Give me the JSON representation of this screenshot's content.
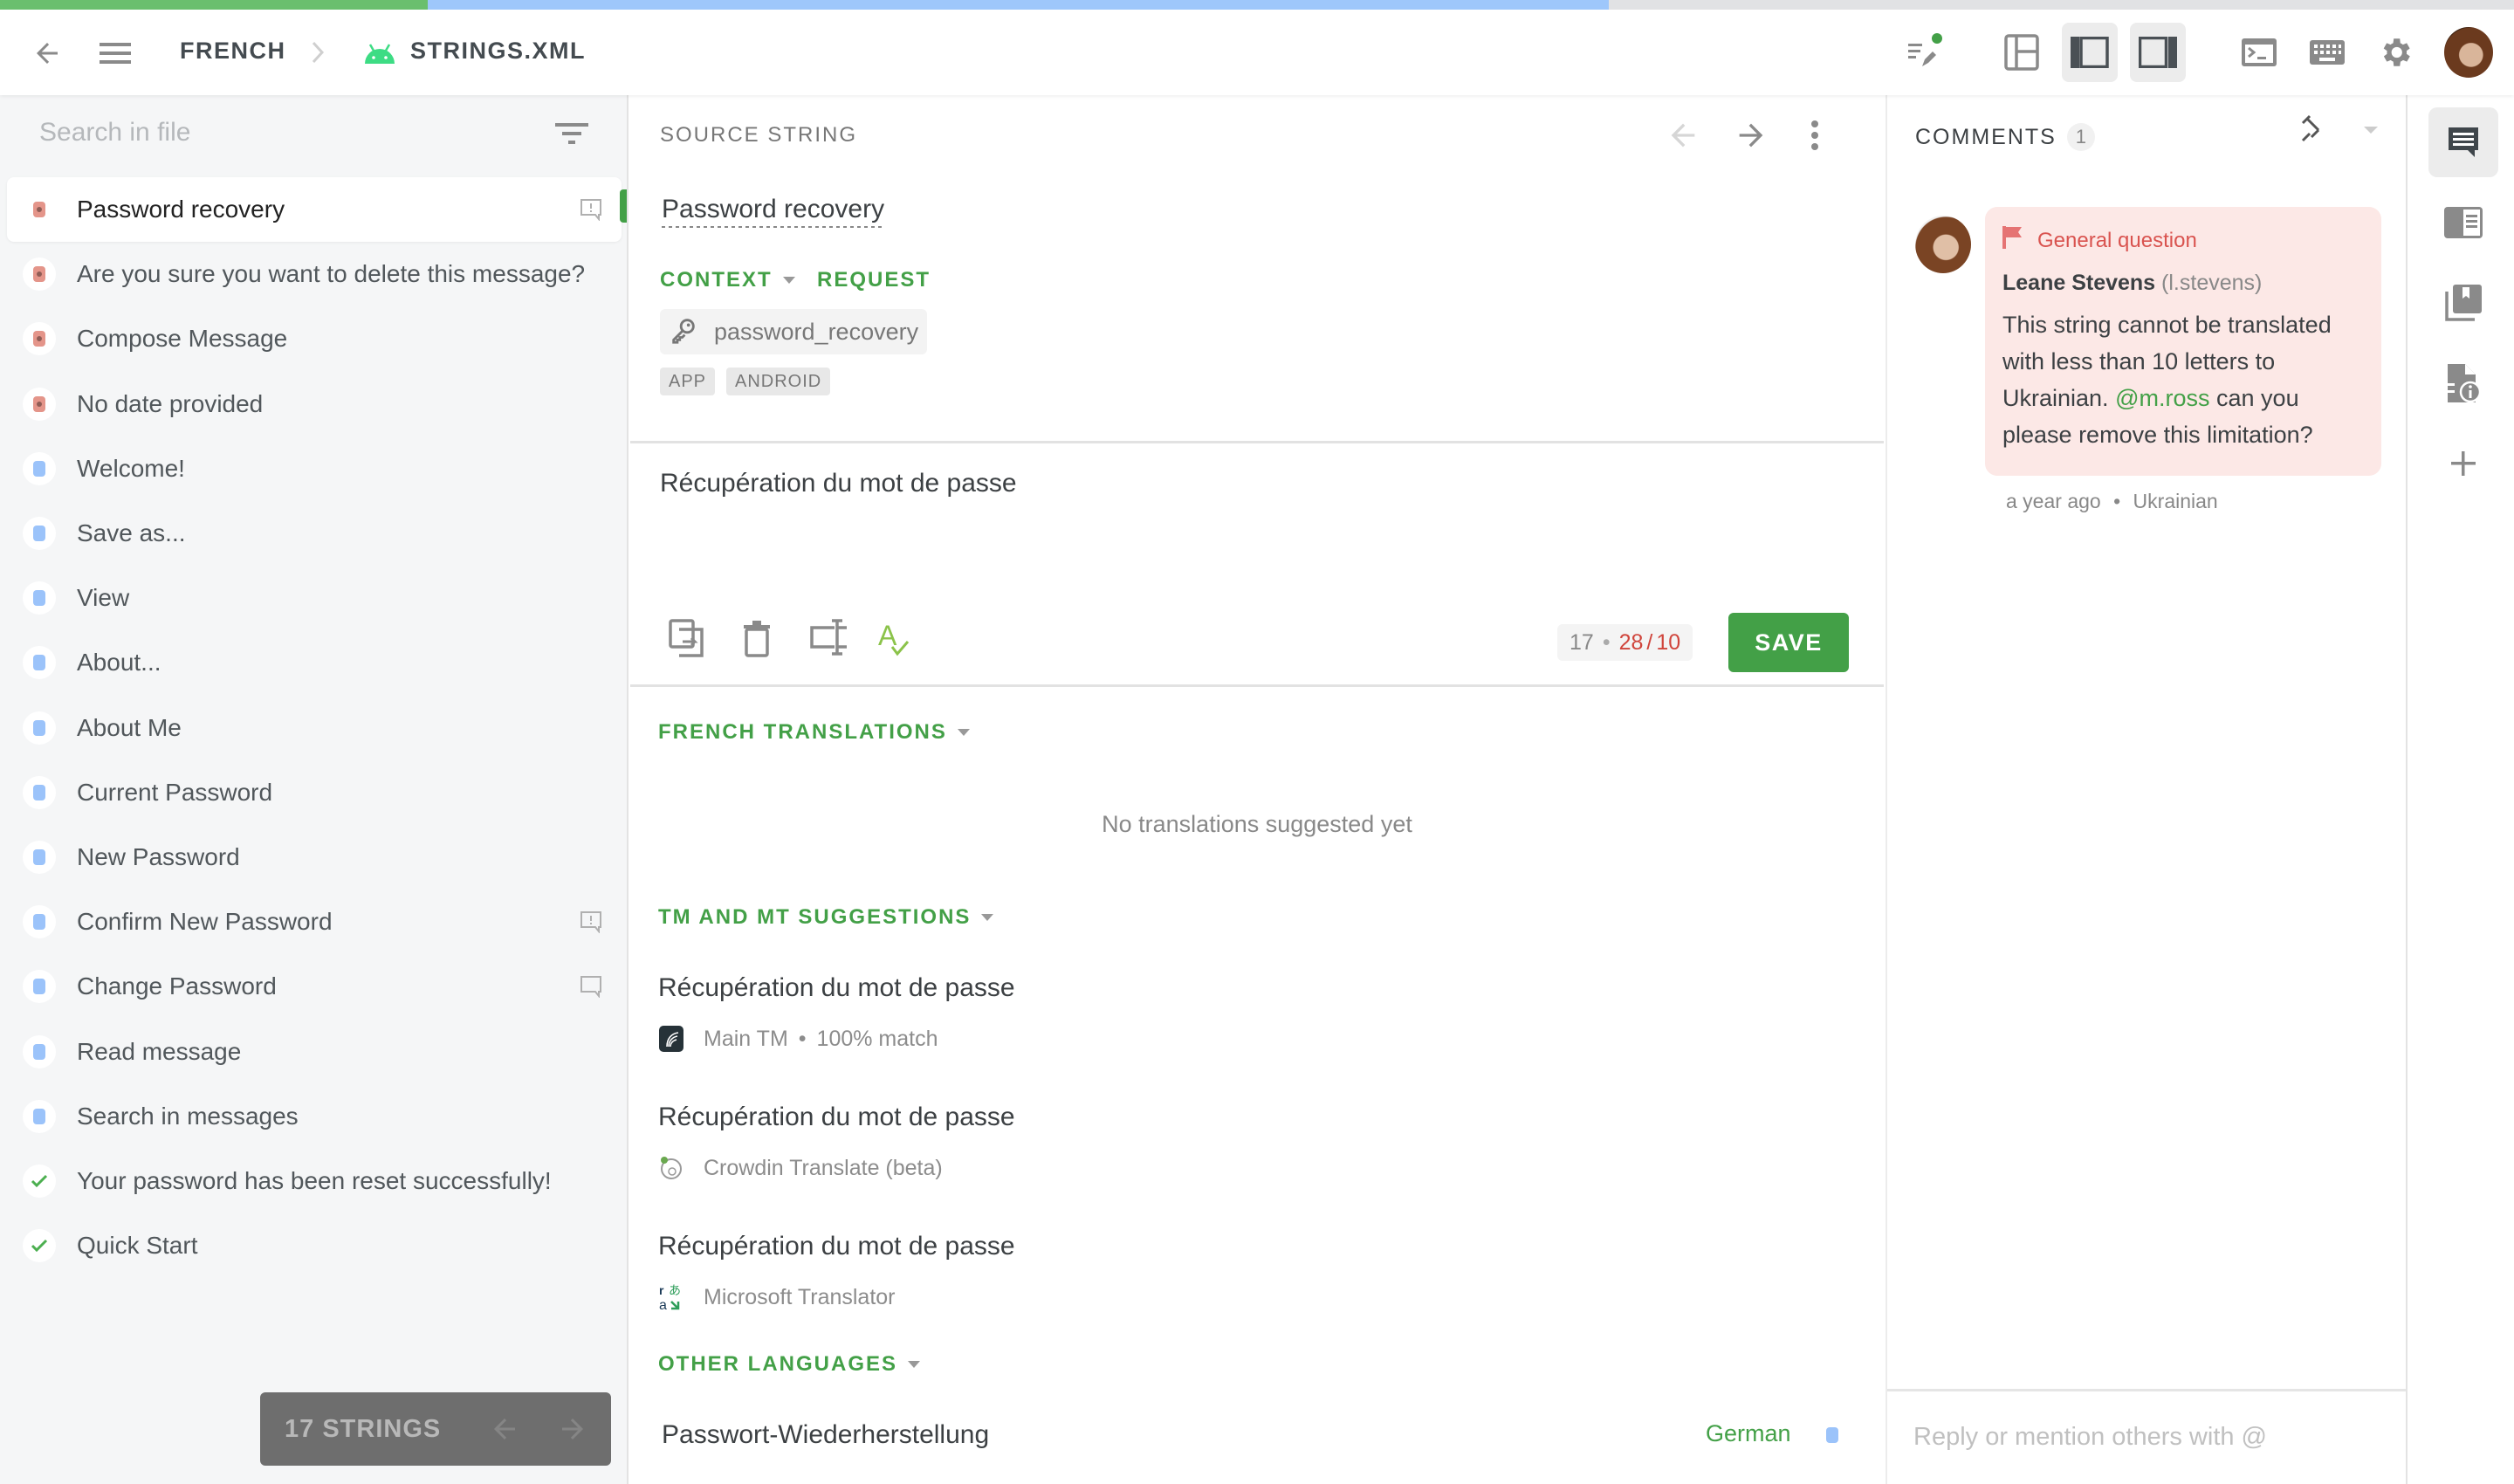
{
  "progress": {
    "approved_fraction": 0.17,
    "translated_fraction": 0.64,
    "approved_color": "#6abf6e",
    "translated_color": "#9ec7fb"
  },
  "header": {
    "back_icon": "arrow-left-icon",
    "menu_icon": "hamburger-menu-icon",
    "breadcrumb": [
      "FRENCH",
      "STRINGS.XML"
    ],
    "file_icon": "android-icon",
    "toolbar_icons": [
      "edit-list-icon",
      "layout-three-panel-icon",
      "layout-left-panel-icon",
      "layout-right-panel-icon",
      "terminal-icon",
      "keyboard-icon",
      "gear-icon",
      "user-avatar"
    ],
    "notification_dot_color": "#43a047"
  },
  "sidebar": {
    "search_placeholder": "Search in file",
    "items": [
      {
        "label": "Password recovery",
        "status": "untranslated",
        "selected": true,
        "comment": "issue"
      },
      {
        "label": "Are you sure you want to delete this message?",
        "status": "untranslated"
      },
      {
        "label": "Compose Message",
        "status": "untranslated"
      },
      {
        "label": "No date provided",
        "status": "untranslated"
      },
      {
        "label": "Welcome!",
        "status": "translated"
      },
      {
        "label": "Save as...",
        "status": "translated"
      },
      {
        "label": "View",
        "status": "translated"
      },
      {
        "label": "About...",
        "status": "translated"
      },
      {
        "label": "About Me",
        "status": "translated"
      },
      {
        "label": "Current Password",
        "status": "translated"
      },
      {
        "label": "New Password",
        "status": "translated"
      },
      {
        "label": "Confirm New Password",
        "status": "translated",
        "comment": "issue"
      },
      {
        "label": "Change Password",
        "status": "translated",
        "comment": "plain"
      },
      {
        "label": "Read message",
        "status": "translated"
      },
      {
        "label": "Search in messages",
        "status": "translated"
      },
      {
        "label": "Your password has been reset successfully!",
        "status": "approved"
      },
      {
        "label": "Quick Start",
        "status": "approved"
      }
    ],
    "strings_count": "17 STRINGS"
  },
  "source": {
    "section_label": "SOURCE STRING",
    "text": "Password recovery",
    "context_label": "CONTEXT",
    "request_label": "REQUEST",
    "key": "password_recovery",
    "tags": [
      "APP",
      "ANDROID"
    ]
  },
  "translation": {
    "value": "Récupération du mot de passe",
    "counter_source": "17",
    "counter_current": "28",
    "counter_limit": "10",
    "save_label": "SAVE"
  },
  "sections": {
    "french_translations": "FRENCH TRANSLATIONS",
    "no_translations": "No translations suggested yet",
    "tm_mt": "TM AND MT SUGGESTIONS",
    "other_languages": "OTHER LANGUAGES"
  },
  "suggestions": [
    {
      "text": "Récupération du mot de passe",
      "source": "Main TM",
      "match": "100% match",
      "icon": "tm-icon"
    },
    {
      "text": "Récupération du mot de passe",
      "source": "Crowdin Translate (beta)",
      "icon": "crowdin-translate-icon"
    },
    {
      "text": "Récupération du mot de passe",
      "source": "Microsoft Translator",
      "icon": "microsoft-translator-icon"
    }
  ],
  "other_languages": [
    {
      "text": "Passwort-Wiederherstellung",
      "language": "German"
    }
  ],
  "comments": {
    "title": "COMMENTS",
    "count": "1",
    "items": [
      {
        "type": "General question",
        "author": "Leane Stevens",
        "username": "(l.stevens)",
        "body_before": "This string cannot be translated with less than 10 letters to Ukrainian.",
        "mention": "@m.ross",
        "body_after": "can you please remove this limitation?",
        "time": "a year ago",
        "language": "Ukrainian"
      }
    ],
    "reply_placeholder": "Reply or mention others with @"
  },
  "rail": {
    "icons": [
      "comments-icon",
      "source-preview-icon",
      "glossary-icon",
      "file-info-icon",
      "add-icon"
    ]
  }
}
